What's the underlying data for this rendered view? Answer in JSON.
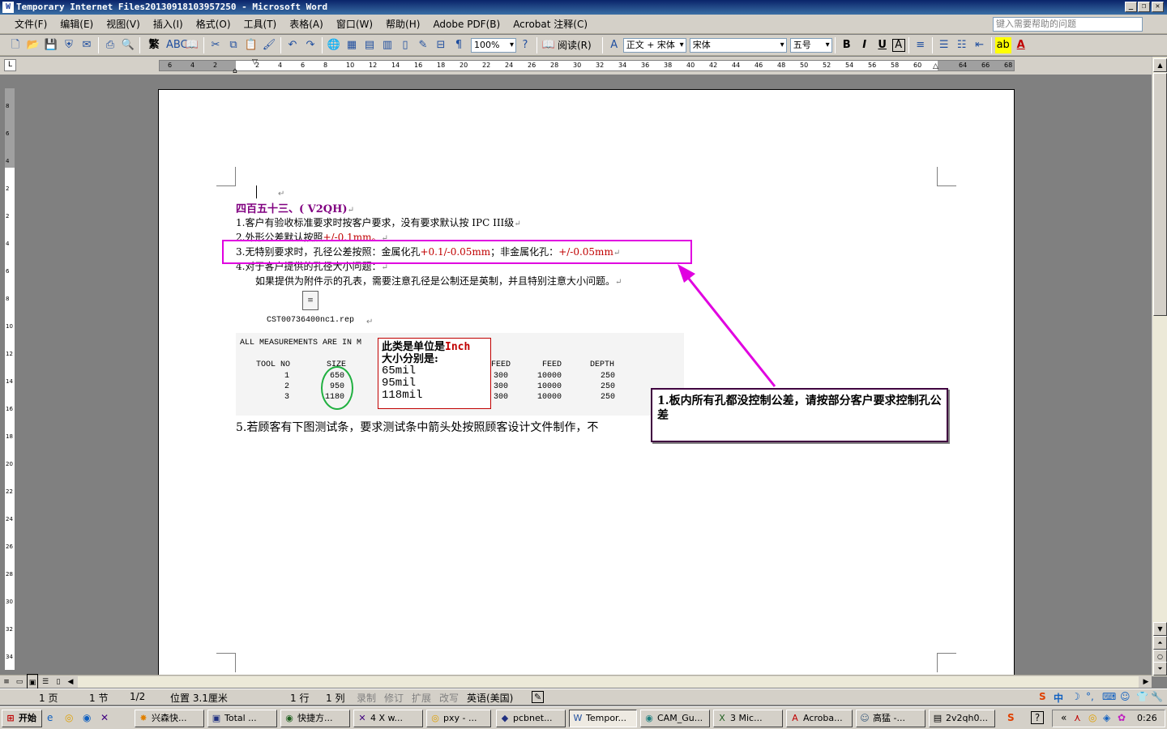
{
  "window": {
    "title": "Temporary Internet Files20130918103957250 - Microsoft Word",
    "app_icon": "W"
  },
  "menu": [
    "文件(F)",
    "编辑(E)",
    "视图(V)",
    "插入(I)",
    "格式(O)",
    "工具(T)",
    "表格(A)",
    "窗口(W)",
    "帮助(H)",
    "Adobe PDF(B)",
    "Acrobat 注释(C)"
  ],
  "help_placeholder": "键入需要帮助的问题",
  "toolbar": {
    "zoom": "100%",
    "read_label": "阅读(R)",
    "style": "正文 + 宋体",
    "font": "宋体",
    "size": "五号",
    "trad_char": "繁"
  },
  "ruler": {
    "h_ticks": [
      "6",
      "4",
      "2",
      "2",
      "4",
      "6",
      "8",
      "10",
      "12",
      "14",
      "16",
      "18",
      "20",
      "22",
      "24",
      "26",
      "28",
      "30",
      "32",
      "34",
      "36",
      "38",
      "40",
      "42",
      "44",
      "46",
      "48",
      "50",
      "52",
      "54",
      "56",
      "58",
      "60",
      "64",
      "66",
      "68"
    ],
    "v_ticks": [
      "8",
      "6",
      "4",
      "2",
      "2",
      "4",
      "6",
      "8",
      "10",
      "12",
      "14",
      "16",
      "18",
      "20",
      "22",
      "24",
      "26",
      "28",
      "30",
      "32",
      "34"
    ]
  },
  "doc": {
    "heading": "四百五十三、(   V2QH)",
    "line1": "1.客户有验收标准要求时按客户要求，没有要求默认按 IPC III级",
    "line2a": "2.外形公差默认按照",
    "line2b": "+/-0.1mm。",
    "line3a": "3.无特别要求时，孔径公差按照：金属化孔",
    "line3b": "+0.1/-0.05mm",
    "line3c": "；非金属化孔：",
    "line3d": "+/-0.05mm",
    "line4": "4.对于客户提供的孔径大小问题：",
    "line4b": "如果提供为附件示的孔表，需要注意孔径是公制还是英制，并且特别注意大小问题。",
    "attachment": "CST00736400nc1.rep",
    "table_header": "ALL MEASUREMENTS ARE IN M",
    "columns": [
      "TOOL NO",
      "SIZE",
      "FEED",
      "FEED",
      "DEPTH"
    ],
    "rows": [
      [
        "1",
        "650",
        "300",
        "10000",
        "250"
      ],
      [
        "2",
        "950",
        "300",
        "10000",
        "250"
      ],
      [
        "3",
        "1180",
        "300",
        "10000",
        "250"
      ]
    ],
    "callout_inch_a": "此类是单位是",
    "callout_inch_b": "Inch",
    "callout_inch_c": "大小分别是:",
    "callout_sizes": [
      "65mil",
      "95mil",
      "118mil"
    ],
    "line5": "5.若顾客有下图测试条，要求测试条中箭头处按照顾客设计文件制作，不",
    "callout_main": "1.板内所有孔都没控制公差，请按部分客户要求控制孔公差"
  },
  "status": {
    "page": "1 页",
    "section": "1 节",
    "pages": "1/2",
    "position": "位置 3.1厘米",
    "line": "1 行",
    "col": "1 列",
    "rec": "录制",
    "trk": "修订",
    "ext": "扩展",
    "ovr": "改写",
    "lang": "英语(美国)"
  },
  "taskbar": {
    "start": "开始",
    "tasks": [
      "兴森快...",
      "Total ...",
      "快捷方...",
      "4 X w...",
      "pxy - ...",
      "pcbnet...",
      "Tempor...",
      "CAM_Gu...",
      "3 Mic...",
      "Acroba...",
      "高猛 -...",
      "2v2qh0..."
    ],
    "time": "0:26",
    "ime": "中"
  },
  "colors": {
    "accent_magenta": "#e000e0",
    "callout_border": "#400040",
    "circle_green": "#20b040",
    "red_text": "#c00000"
  }
}
